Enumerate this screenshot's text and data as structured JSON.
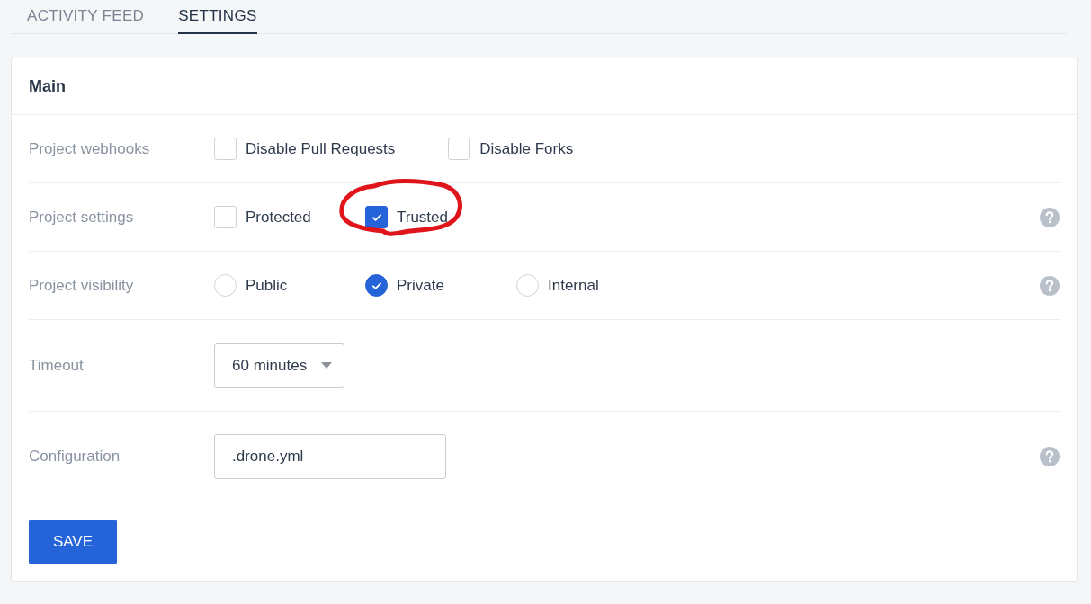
{
  "tabs": [
    {
      "label": "ACTIVITY FEED",
      "selected": false
    },
    {
      "label": "SETTINGS",
      "selected": true
    }
  ],
  "card": {
    "title": "Main",
    "rows": [
      {
        "kind": "checkboxes",
        "label": "Project webhooks",
        "help": false,
        "options": [
          {
            "label": "Disable Pull Requests",
            "checked": false,
            "highlighted": false
          },
          {
            "label": "Disable Forks",
            "checked": false,
            "highlighted": false
          }
        ]
      },
      {
        "kind": "checkboxes",
        "label": "Project settings",
        "help": true,
        "options": [
          {
            "label": "Protected",
            "checked": false,
            "highlighted": false
          },
          {
            "label": "Trusted",
            "checked": true,
            "highlighted": true
          }
        ]
      },
      {
        "kind": "radios",
        "label": "Project visibility",
        "help": true,
        "options": [
          {
            "label": "Public",
            "selected": false
          },
          {
            "label": "Private",
            "selected": true
          },
          {
            "label": "Internal",
            "selected": false
          }
        ]
      },
      {
        "kind": "select",
        "label": "Timeout",
        "help": false,
        "value": "60 minutes"
      },
      {
        "kind": "text",
        "label": "Configuration",
        "help": true,
        "value": ".drone.yml"
      }
    ],
    "save_button": "SAVE"
  }
}
